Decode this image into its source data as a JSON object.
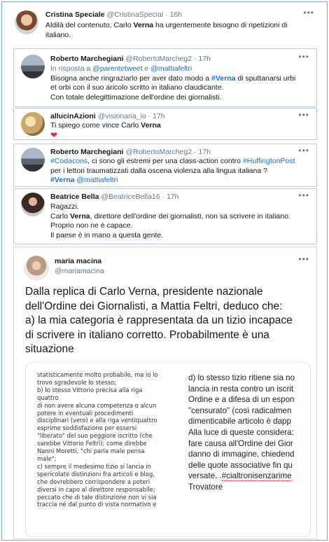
{
  "tweets": [
    {
      "name": "Cristina Speciale",
      "handle": "@CristinaSpecial",
      "time": "· 16h",
      "text_a": "Aldilà del contenuto, Carlo ",
      "text_b": "Verna",
      "text_c": " ha urgentemente bisogno di ripetizioni di",
      "text_d": "italiano."
    },
    {
      "name": "Roberto Marchegiani",
      "handle": "@RobertoMarcheg2",
      "time": "· 17h",
      "reply_prefix": "In risposta a ",
      "reply_user1": "@parentetweet",
      "reply_and": " e ",
      "reply_user2": "@mattiafeltri",
      "line1_a": "Bisogna anche ringraziarlo per aver dato modo a ",
      "line1_b": "#Verna",
      "line1_c": " di sputtanarsi urbi",
      "line2": "et orbi con il suo aricolo scritto in italiano claudicante.",
      "line3": "Con totale delegittimazione dell'ordine dei giornalisti."
    },
    {
      "name": "allucinAzioni",
      "handle": "@visionaria_io",
      "time": "· 17h",
      "text_a": "Ti spiego come vince Carlo ",
      "text_b": "Verna",
      "heart": "❤"
    },
    {
      "name": "Roberto Marchegiani",
      "handle": "@RobertoMarcheg2",
      "time": "· 17h",
      "line1_a": "#Codacons",
      "line1_b": ", ci sono gli estremi per una class-action contro ",
      "line1_c": "#HuffingtonPost",
      "line2": "per i lettori traumatizzati dalla oscena violenza alla lingua italiana ?",
      "tag1": "#Verna",
      "tag2": "@mattiafeltri"
    },
    {
      "name": "Beatrice Bella",
      "handle": "@BeatriceBella16",
      "time": "· 17h",
      "line1": "Ragazzi.",
      "line2_a": "Carlo ",
      "line2_b": "Verna",
      "line2_c": ", direttore dell'ordine dei giornalisti, non sa scrivere in italiano.",
      "line3": "Proprio non ne è capace.",
      "line4": "Il paese è in mano a questa gente."
    },
    {
      "name": "maria macina",
      "handle": "@mariamacina",
      "big_lines": [
        "Dalla replica di Carlo Verna, presidente nazionale",
        "dell'Ordine dei Giornalisti, a Mattia Feltri, deduco che:",
        "a) la mia categoria è rappresentata da un tizio incapace",
        "di scrivere in italiano corretto. Probabilmente è una",
        "situazione"
      ]
    }
  ],
  "document": {
    "left_lines": [
      "statisticamente molto probabile, ma io lo",
      "trovo sgradevole lo stesso;",
      "b) lo stesso Vittorio precisa alla riga quattro",
      "di non avere alcuna competenza o alcun",
      "potere in eventuali procedimenti",
      "disciplinari (vero) e alla riga ventiquattro",
      "esprime soddisfazione per essersi",
      "\"liberato\" del suo peggiore iscritto (che",
      "sarebbe Vittorio Feltri); come direbbe",
      "Nanni Moretti, \"chi parla male pensa",
      "male\";",
      "c) sempre il medesimo tizio si lancia in",
      "spericolate distinzioni fra articoli e blog,",
      "che dovrebbero corrispondere a poteri",
      "diversi in capo al direttore responsabile;",
      "peccato che di tale distinzione non vi sia",
      "traccia né dal punto di vista normativo e"
    ],
    "right_lines": [
      "d) lo stesso tizio ritiene sia no",
      "lancia in resta contro un iscrit",
      "Ordine e a difesa di un espon",
      "\"censurato\" (così radicalmen",
      "dimenticabile articolo è dapp",
      "Alla luce di queste considera:",
      "fare causa all'Ordine dei Gior",
      "danno di immagine, chiedend",
      "delle quote associative fin qu",
      "versate. .",
      "Trovatore"
    ],
    "right_tag": "#cialtronisenzarime"
  },
  "icons": {
    "more": "more-dots-icon",
    "heart": "heart-icon"
  },
  "colors": {
    "link": "#1b6ec2",
    "heart": "#e0245e",
    "frame": "#7aa6d6"
  }
}
